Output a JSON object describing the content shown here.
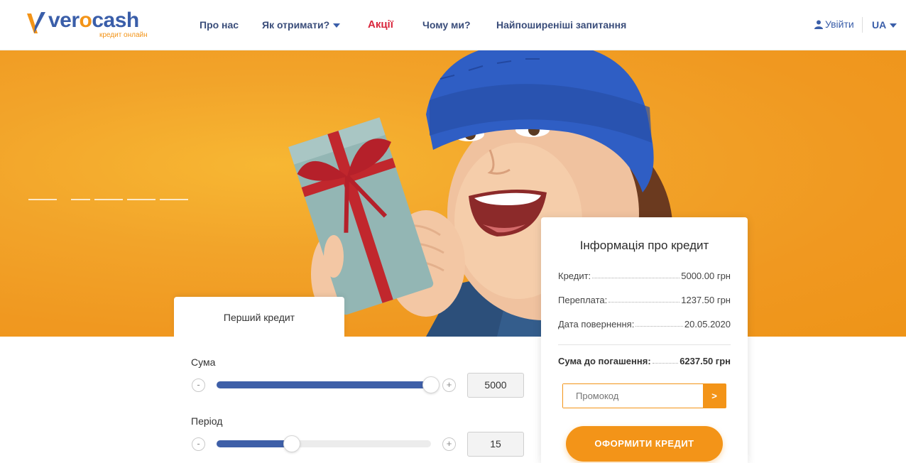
{
  "brand": {
    "name_part1": "ver",
    "name_o": "o",
    "name_part2": "cash",
    "tagline": "кредит онлайн"
  },
  "nav": {
    "items": [
      {
        "label": "Про нас"
      },
      {
        "label": "Як отримати?",
        "has_dropdown": true
      },
      {
        "label": "Акції",
        "highlight": true
      },
      {
        "label": "Чому ми?"
      },
      {
        "label": "Найпоширеніші запитання"
      }
    ],
    "login_label": "Увійти",
    "lang": "UA"
  },
  "hero": {
    "slide_count": 5,
    "active_slide": 1
  },
  "calculator": {
    "tab_label": "Перший кредит",
    "amount": {
      "label": "Сума",
      "value": "5000",
      "fraction": 1.0
    },
    "period": {
      "label": "Період",
      "value": "15",
      "fraction": 0.35
    },
    "minus": "-",
    "plus": "+"
  },
  "credit_info": {
    "title": "Інформація про кредит",
    "rows": [
      {
        "label": "Кредит:",
        "value": "5000.00 грн"
      },
      {
        "label": "Переплата:",
        "value": "1237.50 грн"
      },
      {
        "label": "Дата повернення:",
        "value": "20.05.2020"
      }
    ],
    "total": {
      "label": "Сума до погашення:",
      "value": "6237.50 грн"
    },
    "promo_placeholder": "Промокод",
    "promo_button": ">",
    "submit_label": "ОФОРМИТИ КРЕДИТ"
  },
  "colors": {
    "brand_blue": "#3a5ea9",
    "accent_orange": "#f39418",
    "promo_red": "#d9263c"
  }
}
